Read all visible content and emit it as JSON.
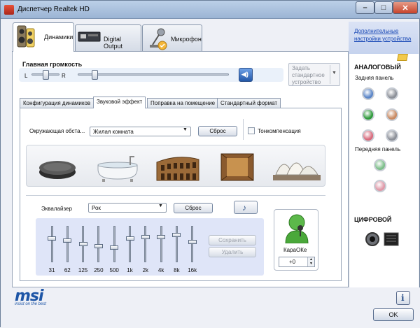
{
  "window": {
    "title": "Диспетчер Realtek HD"
  },
  "top_tabs": [
    {
      "label": "Динамики"
    },
    {
      "label": "Digital Output"
    },
    {
      "label": "Микрофон"
    }
  ],
  "master_volume": {
    "title": "Главная громкость",
    "left_label": "L",
    "right_label": "R",
    "balance": 0.5,
    "volume": 0.1
  },
  "default_device": {
    "label": "Задать стандартное устройство"
  },
  "sub_tabs": [
    {
      "label": "Конфигурация динамиков"
    },
    {
      "label": "Звуковой эффект"
    },
    {
      "label": "Поправка на помещение"
    },
    {
      "label": "Стандартный формат"
    }
  ],
  "environment": {
    "label": "Окружающая обста...",
    "value": "Жилая комната",
    "reset_label": "Сброс",
    "loudness_label": "Тонкомпенсация",
    "loudness_checked": false,
    "presets": [
      "stone-disc-icon",
      "bathtub-icon",
      "colosseum-icon",
      "wooden-room-icon",
      "opera-house-icon"
    ]
  },
  "equalizer": {
    "label": "Эквалайзер",
    "preset": "Рок",
    "reset_label": "Сброс",
    "save_label": "Сохранить",
    "delete_label": "Удалить",
    "bands": [
      {
        "freq": "31",
        "level": 0.35
      },
      {
        "freq": "62",
        "level": 0.4
      },
      {
        "freq": "125",
        "level": 0.5
      },
      {
        "freq": "250",
        "level": 0.55
      },
      {
        "freq": "500",
        "level": 0.6
      },
      {
        "freq": "1k",
        "level": 0.35
      },
      {
        "freq": "2k",
        "level": 0.3
      },
      {
        "freq": "4k",
        "level": 0.3
      },
      {
        "freq": "8k",
        "level": 0.25
      },
      {
        "freq": "16k",
        "level": 0.45
      }
    ]
  },
  "karaoke": {
    "label": "КараОКе",
    "value": "+0"
  },
  "right_panel": {
    "link": "Дополнительные настройки устройства",
    "analog_title": "АНАЛОГОВЫЙ",
    "rear_label": "Задняя панель",
    "front_label": "Передняя панель",
    "digital_title": "ЦИФРОВОЙ",
    "rear_jacks": [
      {
        "color": "#5b86c8"
      },
      {
        "color": "#8c9098"
      },
      {
        "color": "#2e9a3a"
      },
      {
        "color": "#c98a62"
      },
      {
        "color": "#d86a7c"
      },
      {
        "color": "#8c9098"
      }
    ],
    "front_jacks": [
      {
        "color": "#7dbf8a"
      },
      {
        "color": "#e099a8"
      }
    ]
  },
  "footer": {
    "brand": "msi",
    "tagline": "insist on the best",
    "ok_label": "OK"
  }
}
